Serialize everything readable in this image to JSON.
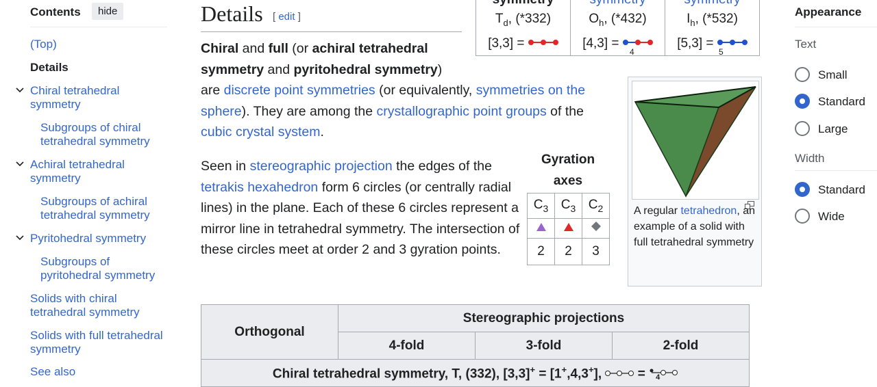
{
  "toc": {
    "title": "Contents",
    "hide_label": "hide",
    "items": [
      {
        "label": "(Top)"
      },
      {
        "label": "Details"
      },
      {
        "label1": "Chiral tetrahedral",
        "label2": "symmetry"
      },
      {
        "label1": "Subgroups of chiral",
        "label2": "tetrahedral symmetry"
      },
      {
        "label1": "Achiral tetrahedral",
        "label2": "symmetry"
      },
      {
        "label1": "Subgroups of achiral",
        "label2": "tetrahedral symmetry"
      },
      {
        "label": "Pyritohedral symmetry"
      },
      {
        "label1": "Subgroups of",
        "label2": "pyritohedral symmetry"
      },
      {
        "label1": "Solids with chiral",
        "label2": "tetrahedral symmetry"
      },
      {
        "label1": "Solids with full tetrahedral",
        "label2": "symmetry"
      },
      {
        "label": "See also"
      }
    ]
  },
  "section": {
    "title": "Details",
    "edit_open": "[ ",
    "edit_label": "edit",
    "edit_close": " ]"
  },
  "para1": {
    "b1": "Chiral",
    "t1": " and ",
    "b2": "full",
    "t2": " (or ",
    "b3": "achiral tetrahedral",
    "b4": "symmetry",
    "t3": " and ",
    "b5": "pyritohedral symmetry",
    "t4": ")",
    "t5": "are ",
    "l1": "discrete point symmetries",
    "t6": " (or equivalently, ",
    "l2a": "symmetries on the",
    "l2b": "sphere",
    "t7": "). They are among the ",
    "l3": "crystallographic point groups",
    "t8": " of the",
    "l4": "cubic crystal system",
    "t9": "."
  },
  "para2": {
    "t1": "Seen in ",
    "l1": "stereographic projection",
    "t2": " the edges of the",
    "l2": "tetrakis hexahedron",
    "t3": " form 6 circles (or centrally radial",
    "t4": "lines) in the plane. Each of these 6 circles represent a",
    "t5": "mirror line in tetrahedral symmetry. The intersection of",
    "t6": "these circles meet at order 2 and 3 gyration points."
  },
  "symtable": {
    "cols": [
      {
        "head": "symmetry",
        "head_link": false,
        "sym": "T",
        "sub": "d",
        "orb": ", (*332)",
        "cox": "[3,3] = ",
        "node_mark": ""
      },
      {
        "head": "symmetry",
        "head_link": true,
        "sym": "O",
        "sub": "h",
        "orb": ", (*432)",
        "cox": "[4,3] = ",
        "node_mark": "4"
      },
      {
        "head": "symmetry",
        "head_link": true,
        "sym": "I",
        "sub": "h",
        "orb": ", (*532)",
        "cox": "[5,3] = ",
        "node_mark": "5"
      }
    ]
  },
  "gyration": {
    "title": "Gyration axes",
    "heads": [
      {
        "c": "C",
        "n": "3"
      },
      {
        "c": "C",
        "n": "3"
      },
      {
        "c": "C",
        "n": "2"
      }
    ],
    "markers": [
      {
        "shape": "triangle",
        "color": "#9966cc"
      },
      {
        "shape": "triangle",
        "color": "#e0282a"
      },
      {
        "shape": "diamond",
        "color": "#72777d"
      }
    ],
    "orders": [
      "2",
      "2",
      "3"
    ]
  },
  "figure": {
    "cap_a": "A regular ",
    "cap_link": "tetrahedron",
    "cap_b": ", an example of a solid with full tetrahedral symmetry",
    "colors": {
      "face_left": "#4a8a4a",
      "face_right": "#7b4a2c",
      "edge": "#1a3a1a"
    }
  },
  "projtable": {
    "orthogonal": "Orthogonal",
    "stereo": "Stereographic projections",
    "folds": [
      "4-fold",
      "3-fold",
      "2-fold"
    ],
    "chiral_row": "Chiral tetrahedral symmetry, T, (332), [3,3]",
    "chiral_sup1": "+",
    "chiral_mid": " = [1",
    "chiral_sup2": "+",
    "chiral_mid2": ",4,3",
    "chiral_sup3": "+",
    "chiral_end": "],",
    "chiral_eq": " = ",
    "chiral_mark": "4"
  },
  "appearance": {
    "title": "Appearance",
    "text_label": "Text",
    "text_options": [
      {
        "label": "Small",
        "selected": false
      },
      {
        "label": "Standard",
        "selected": true
      },
      {
        "label": "Large",
        "selected": false
      }
    ],
    "width_label": "Width",
    "width_options": [
      {
        "label": "Standard",
        "selected": true
      },
      {
        "label": "Wide",
        "selected": false
      }
    ]
  },
  "colors": {
    "link": "#3366cc",
    "text": "#202122",
    "border": "#a2a9b1",
    "header_bg": "#eaecf0",
    "node_red": "#e0282a",
    "node_blue": "#2050d0"
  }
}
